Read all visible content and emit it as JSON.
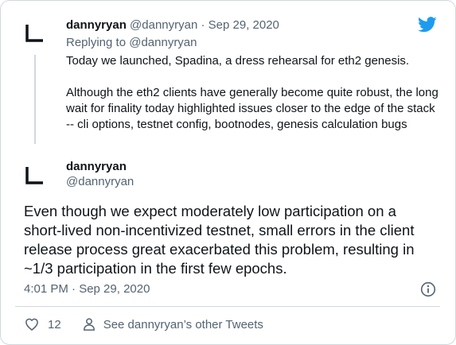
{
  "colors": {
    "brand": "#1d9bf0",
    "text": "#0f1419",
    "muted": "#536471",
    "border": "#cfd9de"
  },
  "icons": {
    "brand": "twitter-bird-icon",
    "info": "info-icon",
    "like": "heart-icon",
    "profile": "person-icon"
  },
  "quoted_tweet": {
    "name": "dannyryan",
    "handle": "@dannyryan",
    "separator": "·",
    "date": "Sep 29, 2020",
    "replying_prefix": "Replying to",
    "replying_to": "@dannyryan",
    "paragraphs": [
      "Today we launched, Spadina, a dress rehearsal for eth2 genesis.",
      "Although the eth2 clients have generally become quite robust, the long wait for finality today highlighted issues closer to the edge of the stack -- cli options, testnet config, bootnodes, genesis calculation bugs"
    ]
  },
  "main_tweet": {
    "name": "dannyryan",
    "handle": "@dannyryan",
    "text": "Even though we expect moderately low participation on a short-lived non-incentivized testnet, small errors in the client release process great exacerbated this problem, resulting in ~1/3 participation in the first few epochs.",
    "timestamp": "4:01 PM · Sep 29, 2020"
  },
  "actions": {
    "like_count": "12",
    "see_tweets_label": "See dannyryan’s other Tweets"
  }
}
